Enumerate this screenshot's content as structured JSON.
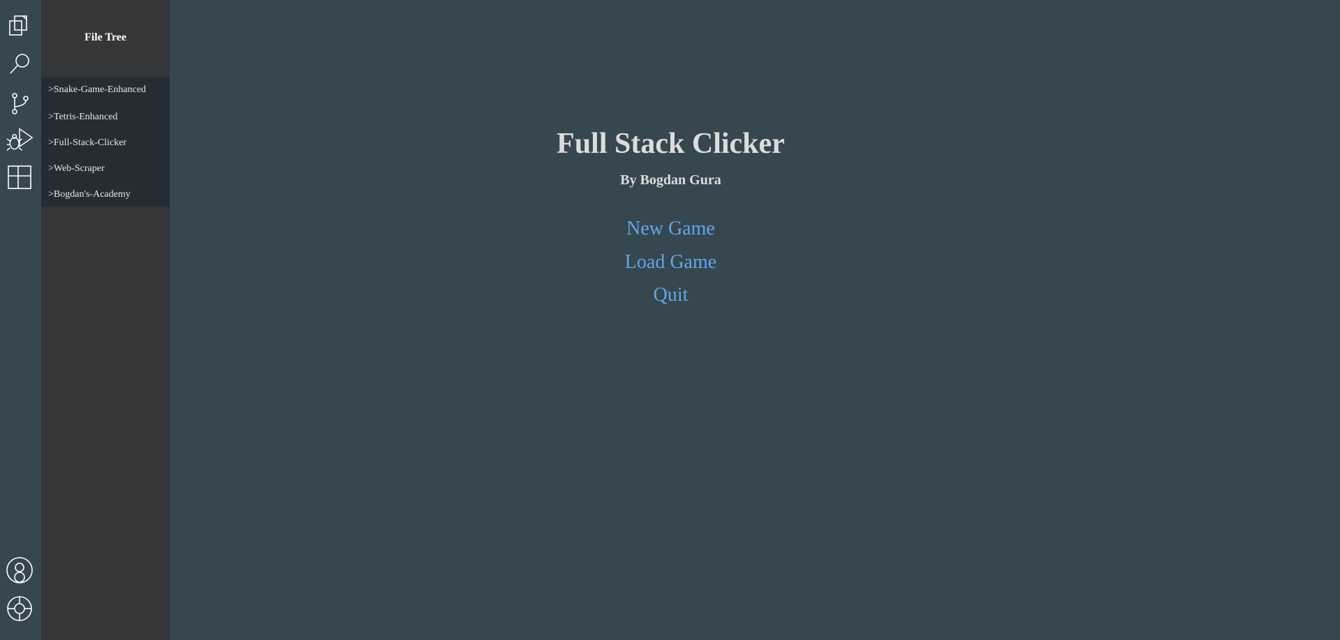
{
  "activity_bar": {
    "icons": [
      {
        "name": "explorer-icon"
      },
      {
        "name": "search-icon"
      },
      {
        "name": "source-control-icon"
      },
      {
        "name": "run-debug-icon"
      },
      {
        "name": "extensions-icon"
      },
      {
        "name": "account-icon"
      },
      {
        "name": "settings-icon"
      }
    ]
  },
  "sidebar": {
    "title": "File Tree",
    "items": [
      {
        "label": ">Snake-Game-Enhanced"
      },
      {
        "label": ">Tetris-Enhanced"
      },
      {
        "label": ">Full-Stack-Clicker"
      },
      {
        "label": ">Web-Scraper"
      },
      {
        "label": ">Bogdan's-Academy"
      }
    ]
  },
  "main": {
    "title": "Full Stack Clicker",
    "author": "By Bogdan Gura",
    "menu": {
      "new_game": "New Game",
      "load_game": "Load Game",
      "quit": "Quit"
    }
  },
  "colors": {
    "background": "#37474f",
    "sidebar": "#353638",
    "tree": "#232d33",
    "link": "#5fa8e8",
    "title": "#dcdcdc"
  }
}
